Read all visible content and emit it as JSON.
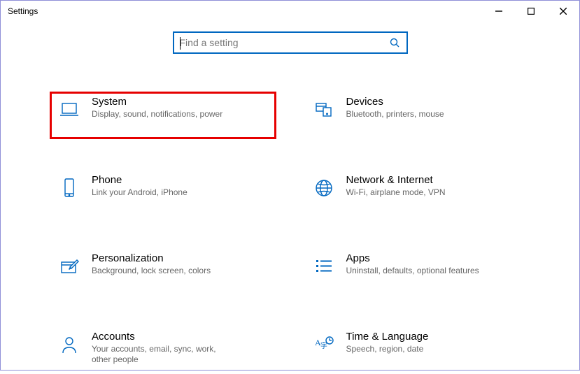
{
  "window": {
    "title": "Settings"
  },
  "search": {
    "placeholder": "Find a setting"
  },
  "tiles": {
    "system": {
      "title": "System",
      "desc": "Display, sound, notifications, power"
    },
    "devices": {
      "title": "Devices",
      "desc": "Bluetooth, printers, mouse"
    },
    "phone": {
      "title": "Phone",
      "desc": "Link your Android, iPhone"
    },
    "network": {
      "title": "Network & Internet",
      "desc": "Wi-Fi, airplane mode, VPN"
    },
    "personalization": {
      "title": "Personalization",
      "desc": "Background, lock screen, colors"
    },
    "apps": {
      "title": "Apps",
      "desc": "Uninstall, defaults, optional features"
    },
    "accounts": {
      "title": "Accounts",
      "desc": "Your accounts, email, sync, work, other people"
    },
    "time": {
      "title": "Time & Language",
      "desc": "Speech, region, date"
    }
  }
}
